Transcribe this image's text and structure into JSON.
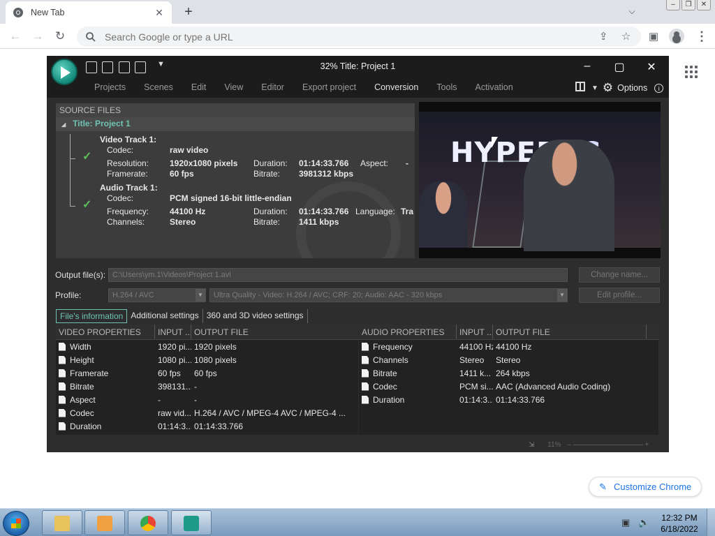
{
  "browser": {
    "tab_title": "New Tab",
    "omnibox_placeholder": "Search Google or type a URL",
    "customize_label": "Customize Chrome"
  },
  "app": {
    "window_title": "32% Title: Project 1",
    "menu": [
      "Projects",
      "Scenes",
      "Edit",
      "View",
      "Editor",
      "Export project",
      "Conversion",
      "Tools",
      "Activation"
    ],
    "active_menu": "Conversion",
    "options_label": "Options"
  },
  "source_files": {
    "header": "SOURCE FILES",
    "project": "Title: Project 1",
    "video_track": {
      "title": "Video Track 1:",
      "codec_label": "Codec:",
      "codec": "raw video",
      "resolution_label": "Resolution:",
      "resolution": "1920x1080 pixels",
      "duration_label": "Duration:",
      "duration": "01:14:33.766",
      "aspect_label": "Aspect:",
      "aspect": "-",
      "framerate_label": "Framerate:",
      "framerate": "60 fps",
      "bitrate_label": "Bitrate:",
      "bitrate": "3981312 kbps"
    },
    "audio_track": {
      "title": "Audio Track 1:",
      "codec_label": "Codec:",
      "codec": "PCM signed 16-bit little-endian",
      "frequency_label": "Frequency:",
      "frequency": "44100 Hz",
      "duration_label": "Duration:",
      "duration": "01:14:33.766",
      "language_label": "Language:",
      "language": "Tra",
      "channels_label": "Channels:",
      "channels": "Stereo",
      "bitrate_label": "Bitrate:",
      "bitrate": "1411 kbps"
    }
  },
  "preview": {
    "brand_text": "HYPER",
    "brand_suffix": "PC"
  },
  "output": {
    "output_label": "Output file(s):",
    "output_path": "C:\\Users\\ym.1\\Videos\\Project 1.avi",
    "change_name": "Change name...",
    "profile_label": "Profile:",
    "profile_codec": "H.264 / AVC",
    "profile_preset": "Ultra Quality - Video: H.264 / AVC; CRF: 20; Audio: AAC - 320 kbps",
    "edit_profile": "Edit profile..."
  },
  "info_tabs": [
    "File's information",
    "Additional settings",
    "360 and 3D video settings"
  ],
  "video_props": {
    "headers": [
      "VIDEO PROPERTIES",
      "INPUT ...",
      "OUTPUT FILE"
    ],
    "rows": [
      [
        "Width",
        "1920 pi...",
        "1920 pixels"
      ],
      [
        "Height",
        "1080 pi...",
        "1080 pixels"
      ],
      [
        "Framerate",
        "60 fps",
        "60 fps"
      ],
      [
        "Bitrate",
        "398131...",
        "-"
      ],
      [
        "Aspect",
        "-",
        "-"
      ],
      [
        "Codec",
        "raw vid...",
        "H.264 / AVC / MPEG-4 AVC / MPEG-4 ..."
      ],
      [
        "Duration",
        "01:14:3...",
        "01:14:33.766"
      ]
    ]
  },
  "audio_props": {
    "headers": [
      "AUDIO PROPERTIES",
      "INPUT ...",
      "OUTPUT FILE"
    ],
    "rows": [
      [
        "Frequency",
        "44100 Hz",
        "44100 Hz"
      ],
      [
        "Channels",
        "Stereo",
        "Stereo"
      ],
      [
        "Bitrate",
        "1411 k...",
        "264 kbps"
      ],
      [
        "Codec",
        "PCM si...",
        "AAC (Advanced Audio Coding)"
      ],
      [
        "Duration",
        "01:14:3...",
        "01:14:33.766"
      ]
    ]
  },
  "zoom": "11%",
  "taskbar": {
    "time": "12:32 PM",
    "date": "6/18/2022"
  },
  "colors": {
    "accent": "#6fc3b3",
    "app_bg": "#2d2d2d",
    "chrome_blue": "#1a73e8"
  }
}
